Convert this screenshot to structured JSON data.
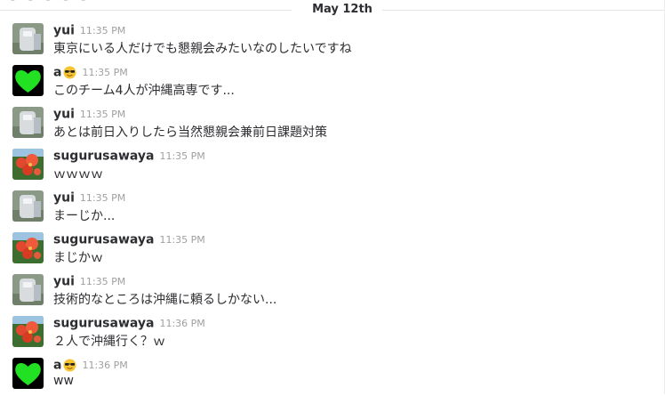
{
  "date_divider": "May 12th",
  "messages": [
    {
      "user": "yui",
      "avatar": "yui",
      "emoji": false,
      "time": "11:35 PM",
      "text": "東京にいる人だけでも懇親会みたいなのしたいですね"
    },
    {
      "user": "a",
      "avatar": "green-heart",
      "emoji": true,
      "time": "11:35 PM",
      "text": "このチーム4人が沖縄高専です..."
    },
    {
      "user": "yui",
      "avatar": "yui",
      "emoji": false,
      "time": "11:35 PM",
      "text": "あとは前日入りしたら当然懇親会兼前日課題対策"
    },
    {
      "user": "sugurusawaya",
      "avatar": "flower",
      "emoji": false,
      "time": "11:35 PM",
      "text": "ｗｗｗｗ"
    },
    {
      "user": "yui",
      "avatar": "yui",
      "emoji": false,
      "time": "11:35 PM",
      "text": "まーじか..."
    },
    {
      "user": "sugurusawaya",
      "avatar": "flower",
      "emoji": false,
      "time": "11:35 PM",
      "text": "まじかｗ"
    },
    {
      "user": "yui",
      "avatar": "yui",
      "emoji": false,
      "time": "11:35 PM",
      "text": "技術的なところは沖縄に頼るしかない..."
    },
    {
      "user": "sugurusawaya",
      "avatar": "flower",
      "emoji": false,
      "time": "11:36 PM",
      "text": "２人で沖縄行く？ｗ"
    },
    {
      "user": "a",
      "avatar": "green-heart",
      "emoji": true,
      "time": "11:36 PM",
      "text": "ww"
    }
  ],
  "icons": {
    "emoji": "sunglasses-emoji"
  }
}
